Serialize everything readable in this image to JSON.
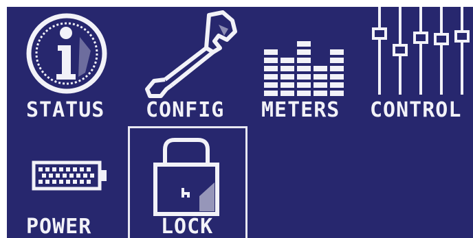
{
  "menu": {
    "items": [
      {
        "label": "STATUS",
        "icon": "info-icon"
      },
      {
        "label": "CONFIG",
        "icon": "wrench-icon"
      },
      {
        "label": "METERS",
        "icon": "bar-meter-icon"
      },
      {
        "label": "CONTROL",
        "icon": "fader-sliders-icon"
      },
      {
        "label": "POWER",
        "icon": "battery-icon"
      },
      {
        "label": "LOCK",
        "icon": "padlock-icon"
      }
    ],
    "selected": "LOCK"
  },
  "colors": {
    "background": "#27276e",
    "foreground": "#f2f2f8"
  }
}
